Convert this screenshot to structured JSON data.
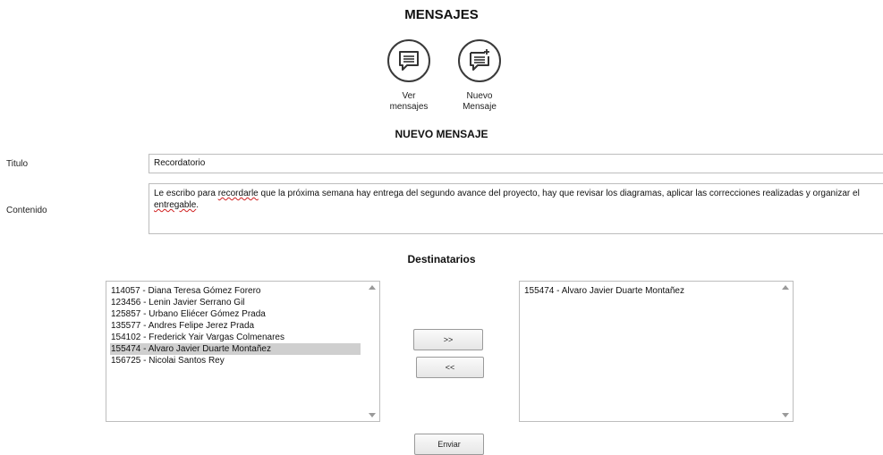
{
  "header": {
    "title": "MENSAJES"
  },
  "actions": [
    {
      "icon": "message-list-icon",
      "label": "Ver\nmensajes"
    },
    {
      "icon": "new-message-icon",
      "label": "Nuevo\nMensaje"
    }
  ],
  "form": {
    "title": "NUEVO MENSAJE",
    "titulo_label": "Titulo",
    "titulo_value": "Recordatorio",
    "contenido_label": "Contenido",
    "contenido_parts": [
      "Le escribo para ",
      "recordarle",
      " que la próxima semana hay entrega del segundo avance del proyecto, hay que revisar los diagramas, aplicar las correcciones realizadas y organizar el ",
      "entregable",
      "."
    ]
  },
  "recipients": {
    "title": "Destinatarios",
    "available": [
      "114057 - Diana Teresa Gómez Forero",
      "123456 - Lenin Javier Serrano Gil",
      "125857 - Urbano Eliécer Gómez Prada",
      "135577 - Andres Felipe Jerez Prada",
      "154102 - Frederick Yair Vargas Colmenares",
      "155474 - Alvaro Javier Duarte Montañez",
      "156725 - Nicolai Santos Rey"
    ],
    "available_selected": "155474 - Alvaro Javier Duarte Montañez",
    "selected": [
      "155474 - Alvaro Javier Duarte Montañez"
    ],
    "add_label": ">>",
    "remove_label": "<<"
  },
  "submit": {
    "label": "Enviar"
  }
}
